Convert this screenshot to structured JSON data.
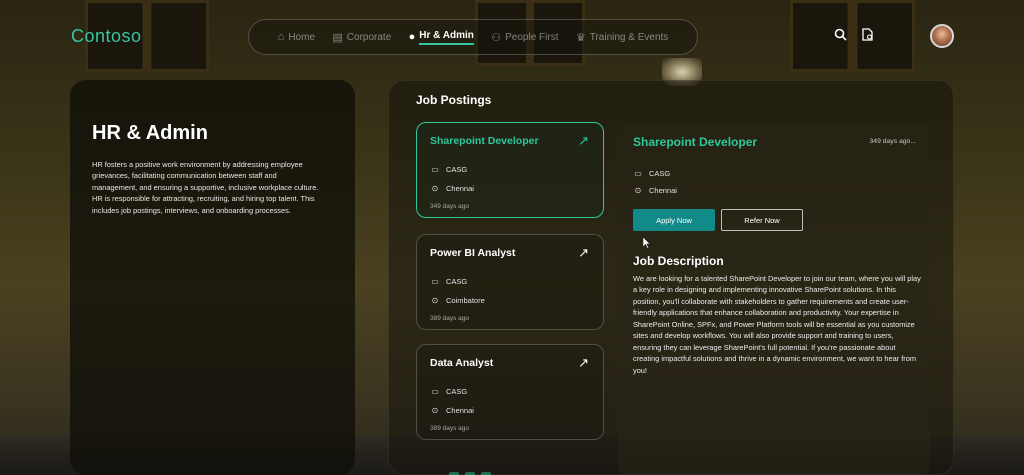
{
  "header": {
    "logo": "Contoso",
    "nav": [
      {
        "label": "Home",
        "icon": "home-icon",
        "glyph": "⌂",
        "active": false
      },
      {
        "label": "Corporate",
        "icon": "building-icon",
        "glyph": "▤",
        "active": false
      },
      {
        "label": "Hr & Admin",
        "icon": "people-settings-icon",
        "glyph": "●",
        "active": true
      },
      {
        "label": "People First",
        "icon": "people-icon",
        "glyph": "⚇",
        "active": false
      },
      {
        "label": "Training & Events",
        "icon": "trophy-icon",
        "glyph": "♛",
        "active": false
      }
    ]
  },
  "sidebar": {
    "title": "HR & Admin",
    "description": "HR fosters a positive work environment by addressing employee grievances, facilitating communication between staff and management, and ensuring a supportive, inclusive workplace culture. HR is responsible for attracting, recruiting, and hiring top talent. This includes job postings, interviews, and onboarding processes."
  },
  "postings": {
    "heading": "Job Postings",
    "jobs": [
      {
        "title": "Sharepoint Developer",
        "company": "CASG",
        "location": "Chennai",
        "age": "349 days ago"
      },
      {
        "title": "Power BI Analyst",
        "company": "CASG",
        "location": "Coimbatore",
        "age": "389 days ago"
      },
      {
        "title": "Data Analyst",
        "company": "CASG",
        "location": "Chennai",
        "age": "389 days ago"
      }
    ]
  },
  "detail": {
    "title": "Sharepoint Developer",
    "age": "349 days ago...",
    "company": "CASG",
    "location": "Chennai",
    "apply_label": "Apply Now",
    "refer_label": "Refer Now",
    "jd_heading": "Job Description",
    "jd_text": "We are looking for a talented SharePoint Developer to join our team, where you will play a key role in designing and implementing innovative SharePoint solutions. In this position, you'll collaborate with stakeholders to gather requirements and create user-friendly applications that enhance collaboration and productivity. Your expertise in SharePoint Online, SPFx, and Power Platform tools will be essential as you customize sites and develop workflows. You will also provide support and training to users, ensuring they can leverage SharePoint's full potential. If you're passionate about creating impactful solutions and thrive in a dynamic environment, we want to hear from you!"
  },
  "colors": {
    "accent": "#2ec79a",
    "apply_button": "#138a8a",
    "logo": "#36c5a0"
  }
}
